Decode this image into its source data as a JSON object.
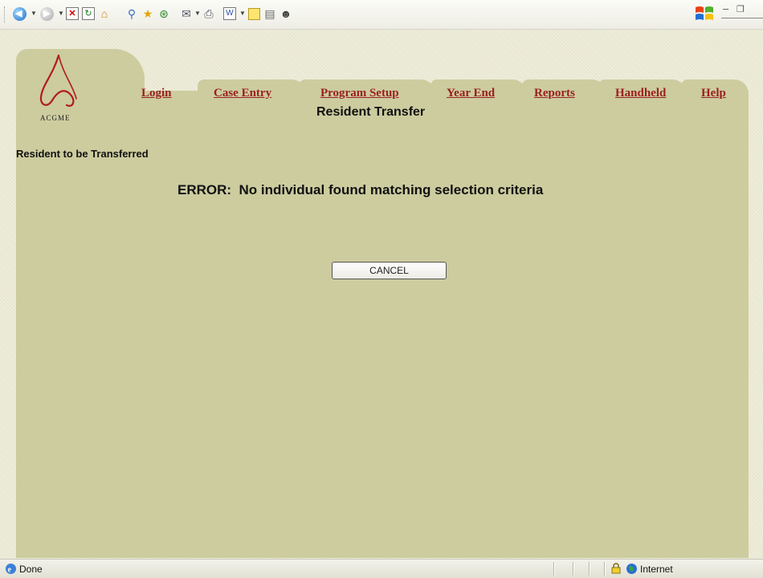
{
  "nav": {
    "items": [
      {
        "label": "Login"
      },
      {
        "label": "Case Entry"
      },
      {
        "label": "Program Setup"
      },
      {
        "label": "Year End"
      },
      {
        "label": "Reports"
      },
      {
        "label": "Handheld"
      },
      {
        "label": "Help"
      }
    ]
  },
  "logo": {
    "text": "ACGME"
  },
  "page": {
    "title": "Resident Transfer",
    "section_label": "Resident to be Transferred",
    "error": "ERROR:  No individual found matching selection criteria",
    "cancel_label": "CANCEL"
  },
  "status": {
    "text": "Done",
    "zone": "Internet"
  },
  "colors": {
    "panel": "#cccc9f",
    "link": "#9b2020",
    "background": "#eeedd9"
  }
}
